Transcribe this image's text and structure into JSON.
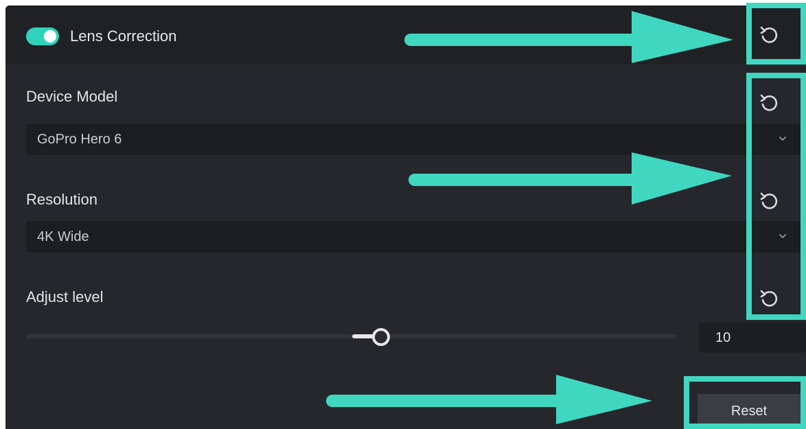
{
  "header": {
    "title": "Lens Correction",
    "toggle_on": true
  },
  "device_model": {
    "label": "Device Model",
    "selected": "GoPro Hero 6"
  },
  "resolution": {
    "label": "Resolution",
    "selected": "4K Wide"
  },
  "adjust_level": {
    "label": "Adjust level",
    "value": "10"
  },
  "footer": {
    "reset_label": "Reset"
  },
  "colors": {
    "accent": "#2fd3bc",
    "annotation": "#40d7c1",
    "panel_bg": "#25272c"
  },
  "icons": {
    "reset": "counterclockwise-reset-icon",
    "dropdown": "chevron-down-icon",
    "arrow": "annotation-arrow"
  }
}
